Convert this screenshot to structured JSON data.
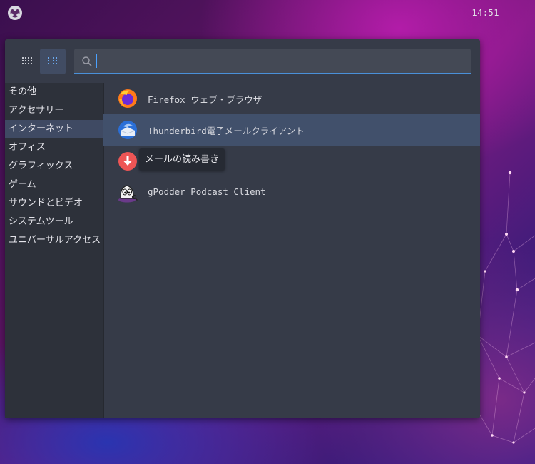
{
  "topbar": {
    "clock": "14:51",
    "logo_icon": "budgie-menu-icon"
  },
  "menu": {
    "view_buttons": [
      {
        "name": "grid-view-button",
        "icon": "grid-icon"
      },
      {
        "name": "list-view-button",
        "icon": "list-icon",
        "active": true
      }
    ],
    "search": {
      "value": "",
      "placeholder": ""
    },
    "categories": [
      {
        "label": "その他"
      },
      {
        "label": "アクセサリー"
      },
      {
        "label": "インターネット",
        "active": true
      },
      {
        "label": "オフィス"
      },
      {
        "label": "グラフィックス"
      },
      {
        "label": "ゲーム"
      },
      {
        "label": "サウンドとビデオ"
      },
      {
        "label": "システムツール"
      },
      {
        "label": "ユニバーサルアクセス"
      }
    ],
    "apps": [
      {
        "label": "Firefox ウェブ・ブラウザ",
        "icon": "firefox-icon"
      },
      {
        "label": "Thunderbird電子メールクライアント",
        "icon": "thunderbird-icon",
        "selected": true
      },
      {
        "label": "",
        "icon": "download-icon"
      },
      {
        "label": "gPodder Podcast Client",
        "icon": "gpodder-icon"
      }
    ],
    "tooltip": "メールの読み書き"
  },
  "colors": {
    "accent": "#4a90d9",
    "selected_row": "#41506b",
    "panel": "#363b48",
    "sidebar": "#2d313a"
  }
}
